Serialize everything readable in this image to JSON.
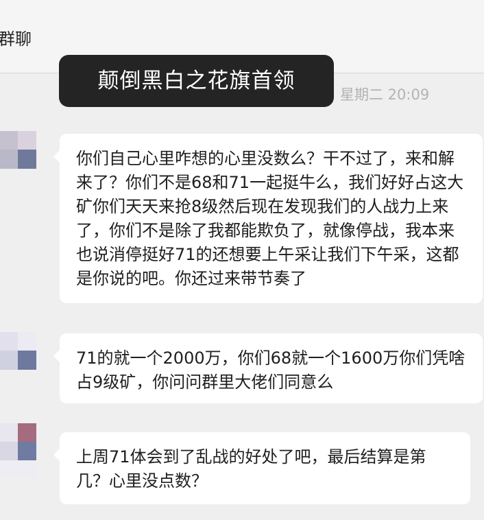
{
  "header": {
    "title": "群聊"
  },
  "tooltip": {
    "text": "颠倒黑白之花旗首领"
  },
  "timestamp": "星期二 20:09",
  "messages": [
    {
      "text": "你们自己心里咋想的心里没数么？干不过了，来和解来了？你们不是68和71一起挺牛么，我们好好占这大矿你们天天来抢8级然后现在发现我们的人战力上来了，你们不是除了我都能欺负了，就像停战，我本来也说消停挺好71的还想要上午采让我们下午采，这都是你说的吧。你还过来带节奏了"
    },
    {
      "text": "71的就一个2000万，你们68就一个1600万你们凭啥占9级矿，你问问群里大佬们同意么"
    },
    {
      "text": "上周71体会到了乱战的好处了吧，最后结算是第几？心里没点数？"
    }
  ],
  "colors": {
    "background": "#efefef",
    "bubble": "#ffffff",
    "tooltip_bg": "#242424",
    "timestamp": "#b3b3b3"
  }
}
